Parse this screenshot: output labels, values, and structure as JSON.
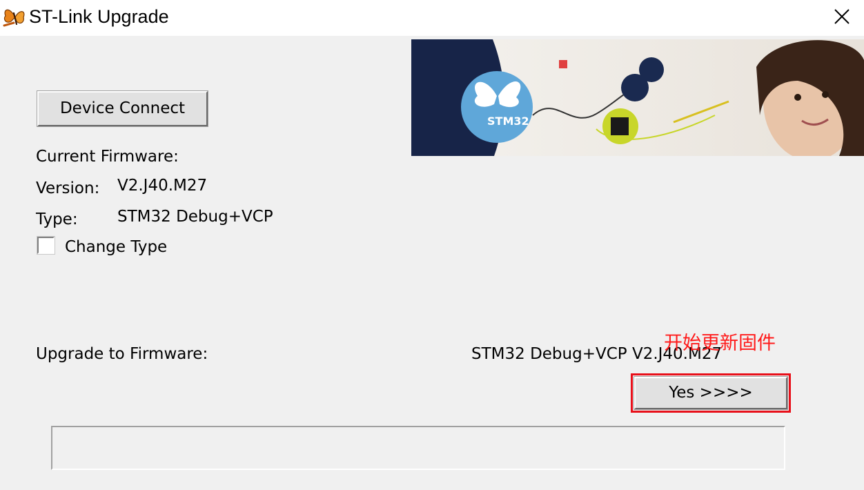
{
  "window": {
    "title": "ST-Link Upgrade",
    "close_icon": "close-icon"
  },
  "banner": {
    "logo_text": "STM32"
  },
  "connect_button": "Device Connect",
  "current_firmware": {
    "heading": "Current Firmware:",
    "version_label": "Version:",
    "version_value": "V2.J40.M27",
    "type_label": "Type:",
    "type_value": "STM32 Debug+VCP"
  },
  "change_type": {
    "label": "Change Type",
    "checked": false
  },
  "upgrade": {
    "label": "Upgrade to Firmware:",
    "target": "STM32 Debug+VCP  V2.J40.M27",
    "button": "Yes >>>>"
  },
  "annotation": {
    "text": "开始更新固件",
    "color": "#ff1a1a"
  },
  "progress": {
    "value": 0
  }
}
